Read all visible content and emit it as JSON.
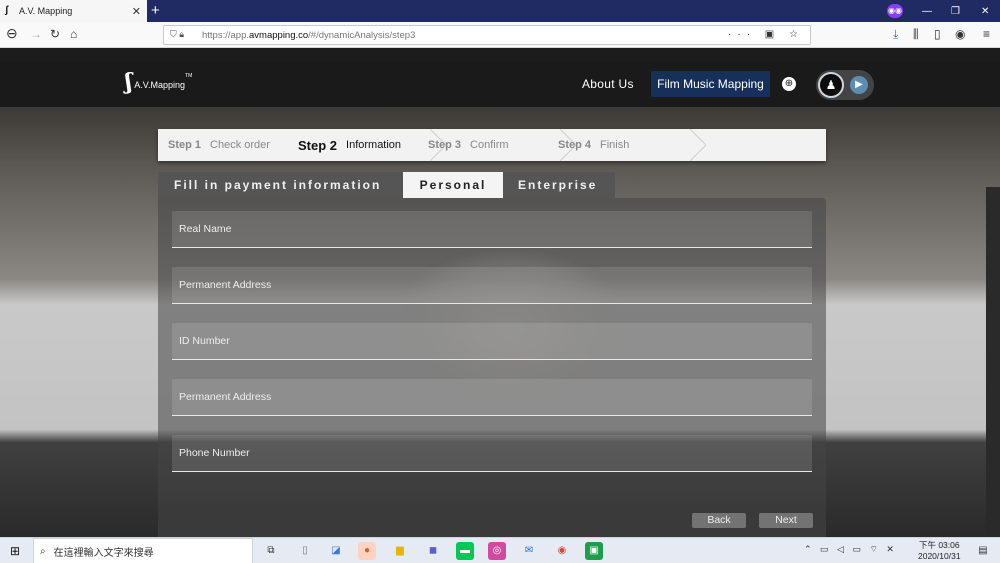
{
  "browser": {
    "tab_title": "A.V. Mapping",
    "tab_close": "✕",
    "new_tab": "+",
    "url_scheme": "https://app.",
    "url_domain": "avmapping.co",
    "url_path": "/#/dynamicAnalysis/step3",
    "url_icons": "··· ▣ ☆",
    "minimize": "—",
    "restore": "❐",
    "close": "✕"
  },
  "site": {
    "logo_mark": "ʃ",
    "logo_name": "A.V.Mapping",
    "logo_tm": "TM",
    "about": "About Us",
    "film_button": "Film Music Mapping"
  },
  "steps": [
    {
      "num": "Step 1",
      "label": "Check order"
    },
    {
      "num": "Step 2",
      "label": "Information"
    },
    {
      "num": "Step 3",
      "label": "Confirm"
    },
    {
      "num": "Step 4",
      "label": "Finish"
    }
  ],
  "form": {
    "heading": "Fill in payment information",
    "tab_personal": "Personal",
    "tab_enterprise": "Enterprise",
    "fields": [
      "Real Name",
      "Permanent Address",
      "ID Number",
      "Permanent Address",
      "Phone Number"
    ],
    "back": "Back",
    "next": "Next"
  },
  "taskbar": {
    "search_placeholder": "在這裡輸入文字來搜尋",
    "time": "下午 03:06",
    "date": "2020/10/31"
  },
  "colors": {
    "accent": "#17305a",
    "titlebar": "#202a63"
  }
}
